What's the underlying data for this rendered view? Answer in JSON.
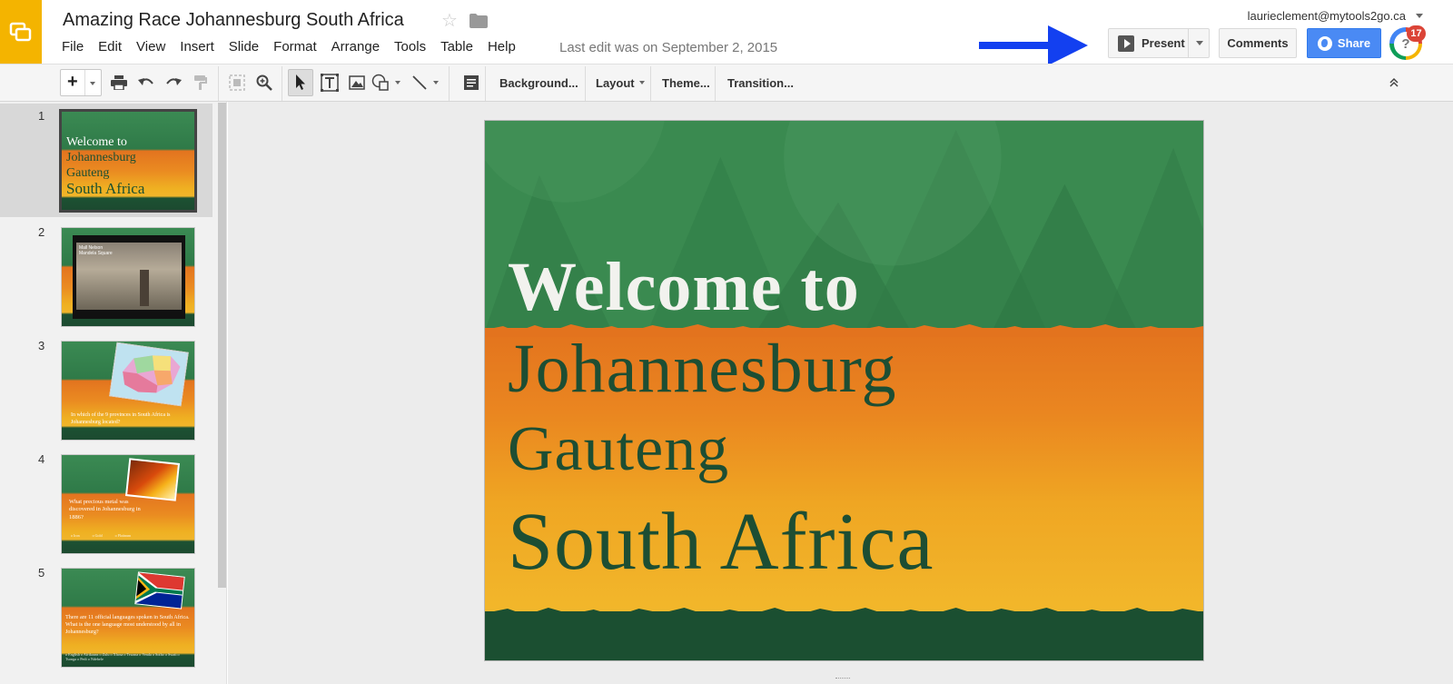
{
  "header": {
    "doc_title": "Amazing Race Johannesburg South Africa",
    "last_edit": "Last edit was on September 2, 2015",
    "account": "laurieclement@mytools2go.ca",
    "present_label": "Present",
    "comments_label": "Comments",
    "share_label": "Share",
    "notification_count": "17",
    "help_glyph": "?"
  },
  "menu": [
    "File",
    "Edit",
    "View",
    "Insert",
    "Slide",
    "Format",
    "Arrange",
    "Tools",
    "Table",
    "Help"
  ],
  "toolbar": {
    "background_label": "Background...",
    "layout_label": "Layout",
    "theme_label": "Theme...",
    "transition_label": "Transition..."
  },
  "slides": [
    {
      "number": "1",
      "lines": [
        "Welcome to",
        "Johannesburg",
        "Gauteng",
        "South Africa"
      ]
    },
    {
      "number": "2",
      "caption": "Mall Nelson Mandela Square"
    },
    {
      "number": "3",
      "text": "In which of the 9 provinces in South Africa is Johannesburg located?"
    },
    {
      "number": "4",
      "text": "What precious metal was discovered in Johannesburg in 1886?",
      "options": [
        "o Iron",
        "o Gold",
        "o Platinum"
      ]
    },
    {
      "number": "5",
      "text": "There are 11 official languages spoken in South Africa. What is the one language most understood by all in Johannesburg?",
      "options": "o English o Afrikaans o Zulu o Xhosa o Tswana o Venda o Sotho o Swati o Tsonga o Pedi o Ndebele"
    }
  ],
  "main_slide": {
    "line1": "Welcome to",
    "line2": "Johannesburg",
    "line3": "Gauteng",
    "line4": "South Africa"
  },
  "colors": {
    "slides_brand": "#f4b400",
    "share_blue": "#4a8af4",
    "slide_green": "#3a8a50",
    "slide_orange": "#e3731e",
    "slide_dark": "#1b4f31",
    "annotation_arrow": "#1340f0"
  },
  "icons": [
    "slides-logo-icon",
    "star-icon",
    "folder-icon",
    "play-icon",
    "globe-icon",
    "print-icon",
    "undo-icon",
    "redo-icon",
    "paint-format-icon",
    "zoom-fit-icon",
    "zoom-icon",
    "select-arrow-icon",
    "textbox-icon",
    "image-icon",
    "shape-icon",
    "line-icon",
    "speaker-notes-icon",
    "collapse-icon"
  ]
}
